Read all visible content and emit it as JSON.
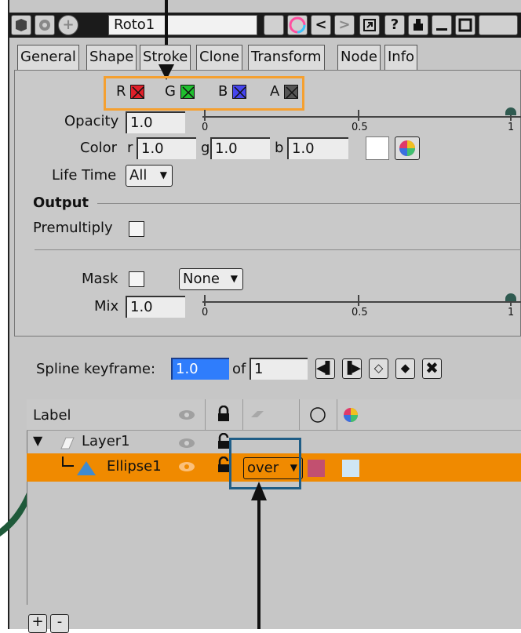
{
  "window": {
    "name": "Roto1",
    "toolbar_icons": [
      "cube-icon",
      "gear-icon",
      "plus-icon",
      "blank-icon",
      "color-wheel-icon",
      "left-arrow-icon",
      "right-arrow-icon",
      "restore-icon",
      "help-icon",
      "pin-icon",
      "minimize-icon",
      "maximize-icon"
    ],
    "help_glyph": "?"
  },
  "tabs": [
    "General",
    "Shape",
    "Stroke",
    "Clone",
    "Transform",
    "Node",
    "Info"
  ],
  "channels": [
    {
      "label": "R",
      "color": "#e0202a"
    },
    {
      "label": "G",
      "color": "#1fbf2f"
    },
    {
      "label": "B",
      "color": "#4545ee"
    },
    {
      "label": "A",
      "color": "#555555"
    }
  ],
  "opacity": {
    "label": "Opacity",
    "value": "1.0",
    "scale": [
      "0",
      "0.5",
      "1"
    ],
    "slider_value": 1.0
  },
  "color": {
    "label": "Color",
    "r_label": "r",
    "r": "1.0",
    "g_label": "g",
    "g": "1.0",
    "b_label": "b",
    "b": "1.0",
    "swatch": "#ffffff"
  },
  "lifetime": {
    "label": "Life Time",
    "value": "All"
  },
  "output": {
    "heading": "Output",
    "premultiply_label": "Premultiply"
  },
  "mask": {
    "label": "Mask",
    "source": "None"
  },
  "mix": {
    "label": "Mix",
    "value": "1.0",
    "scale": [
      "0",
      "0.5",
      "1"
    ],
    "slider_value": 1.0
  },
  "spline": {
    "label": "Spline keyframe:",
    "value": "1.0",
    "of_label": "of",
    "total": "1"
  },
  "layers": {
    "header": {
      "label": "Label"
    },
    "rows": [
      {
        "name": "Layer1",
        "expander": "▼"
      },
      {
        "name": "Ellipse1",
        "blend": "over",
        "color_swatch": "#c25070",
        "overlay_swatch": "#cfe6f5"
      }
    ]
  },
  "bottom_buttons": [
    "+",
    "-"
  ],
  "annotation_colors": {
    "highlight": "#f5a030",
    "focus": "#1f5d86",
    "accent": "#1f5a3a"
  }
}
